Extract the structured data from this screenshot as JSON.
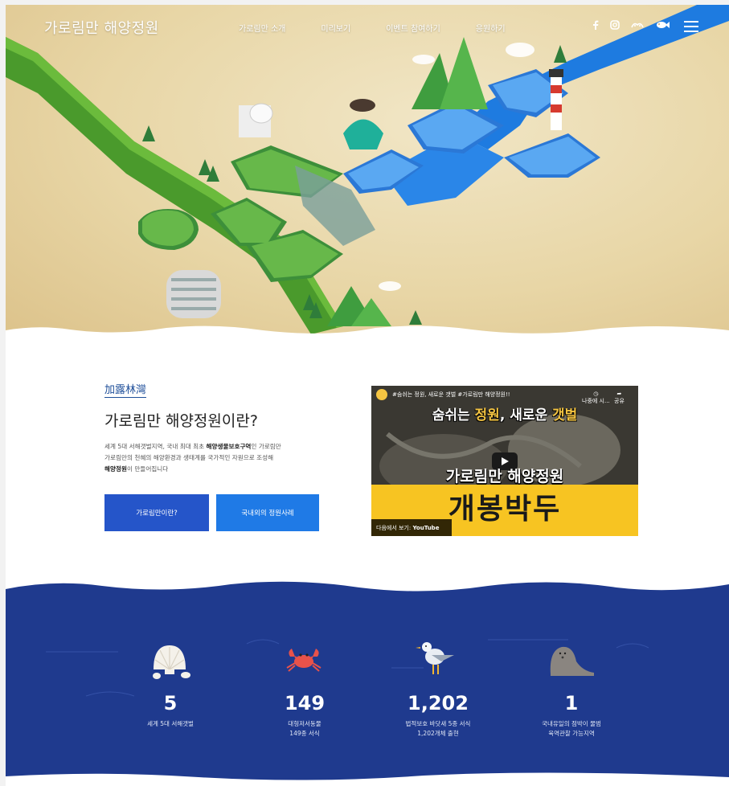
{
  "header": {
    "logo": "가로림만 해양정원",
    "menu": [
      "가로림만 소개",
      "미리보기",
      "이벤트 참여하기",
      "응원하기"
    ],
    "social": [
      "facebook-icon",
      "instagram-icon",
      "band-icon",
      "fish-icon"
    ]
  },
  "intro": {
    "hanja": "加露林灣",
    "title": "가로림만 해양정원이란?",
    "desc_line1_a": "세계 5대 서해갯벌지역, 국내 최대 최초 ",
    "desc_line1_b": "해양생물보호구역",
    "desc_line1_c": "인 가로림만",
    "desc_line2": "가로림만의 천혜의 해양환경과 생태계를 국가적인 자원으로 조성해",
    "desc_line3_a": "해양정원",
    "desc_line3_b": "이 만들어집니다",
    "btn_about": "가로림만이란?",
    "btn_cases": "국내외의 정원사례"
  },
  "video": {
    "top_caption": "#숨쉬는 정원, 새로운 갯벌 #가로림만 해양정원!!",
    "headline_a": "숨쉬는 ",
    "headline_b": "정원",
    "headline_c": ", 새로운 ",
    "headline_d": "갯벌",
    "subtitle": "가로림만 해양정원",
    "big_text": "개봉박두",
    "watch_later": "나중에 시...",
    "share": "공유",
    "watch_on": "다음에서 보기:",
    "youtube": "YouTube"
  },
  "stats": [
    {
      "icon": "shell-icon",
      "value": "5",
      "label1": "세계 5대 서해갯벌",
      "label2": ""
    },
    {
      "icon": "crab-icon",
      "value": "149",
      "label1": "대형저서동물",
      "label2": "149종 서식"
    },
    {
      "icon": "seagull-icon",
      "value": "1,202",
      "label1": "법적보호 바닷새 5종 서식",
      "label2": "1,202개체 출현"
    },
    {
      "icon": "seal-icon",
      "value": "1",
      "label1": "국내유일의 점박이 물범",
      "label2": "육역관찰 가능지역"
    }
  ],
  "colors": {
    "navy": "#1f3a8e",
    "btn_blue": "#2555c9",
    "btn_light": "#1f7ae6",
    "hanja": "#1f4f9a"
  }
}
